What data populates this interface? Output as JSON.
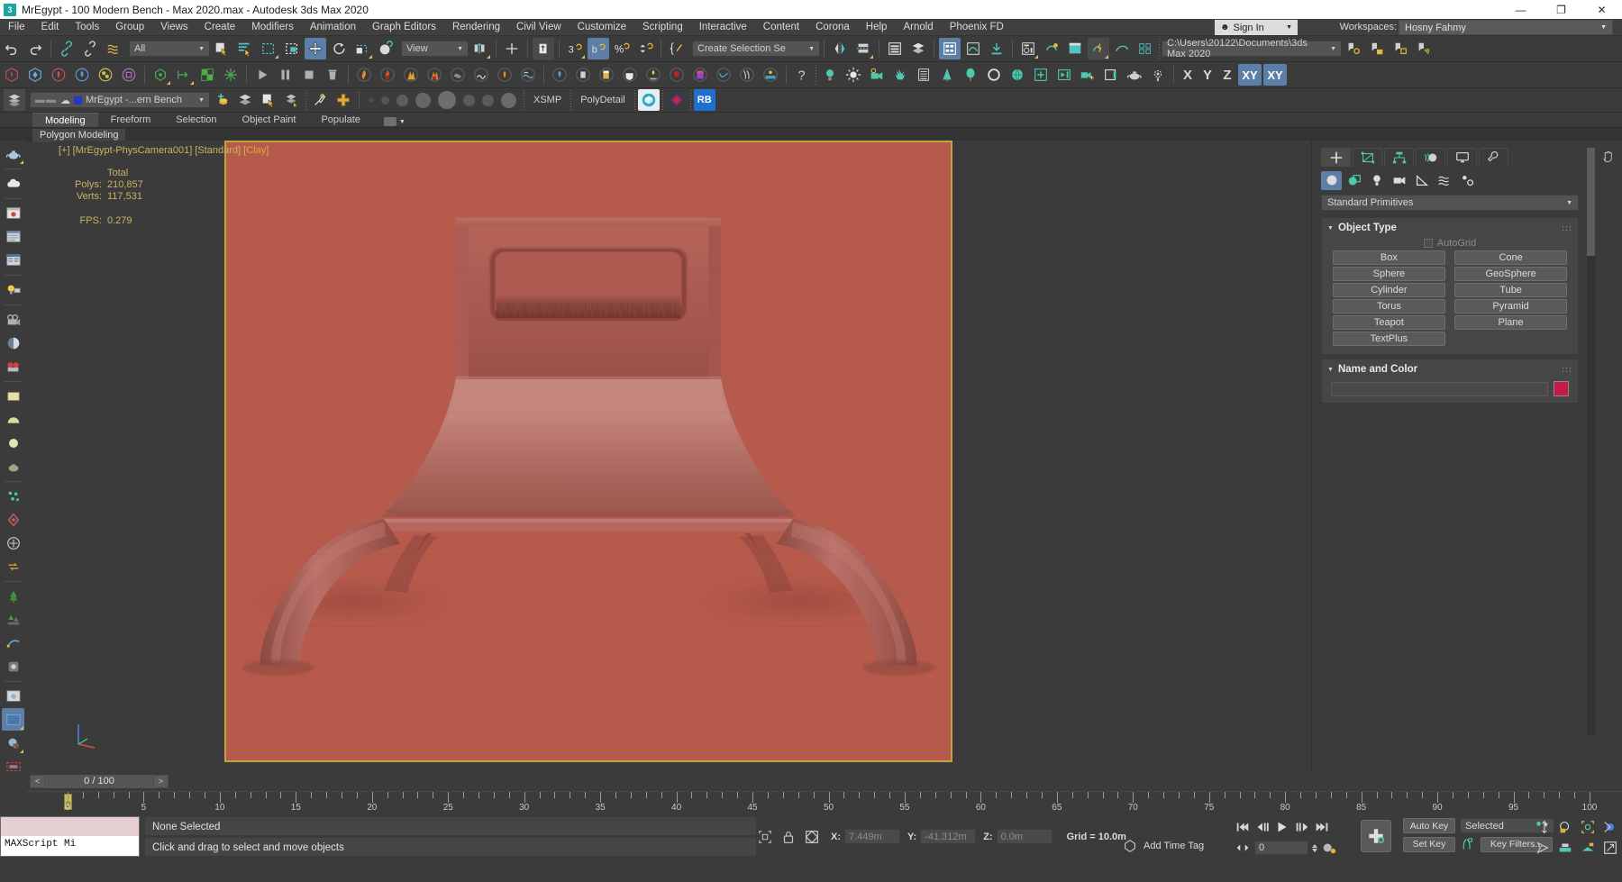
{
  "window": {
    "title": "MrEgypt - 100 Modern Bench - Max 2020.max - Autodesk 3ds Max 2020",
    "app_badge": "3",
    "minimize": "—",
    "maximize": "❐",
    "close": "✕"
  },
  "menu": {
    "items": [
      "File",
      "Edit",
      "Tools",
      "Group",
      "Views",
      "Create",
      "Modifiers",
      "Animation",
      "Graph Editors",
      "Rendering",
      "Civil View",
      "Customize",
      "Scripting",
      "Interactive",
      "Content",
      "Corona",
      "Help",
      "Arnold",
      "Phoenix FD"
    ],
    "sign_in": "Sign In",
    "workspaces_label": "Workspaces:",
    "workspace_value": "Hosny Fahmy"
  },
  "toolbar": {
    "selection_filter": "All",
    "reference_coord": "View",
    "named_selection_sets": "Create Selection Se",
    "project_folder": "C:\\Users\\20122\\Documents\\3ds Max 2020",
    "axis_x": "X",
    "axis_y": "Y",
    "axis_z": "Z",
    "axis_xy": "XY",
    "axis_xy2": "XY",
    "layer_name": "MrEgypt -...ern Bench",
    "plugin_xsmp": "XSMP",
    "plugin_polydetail": "PolyDetail",
    "plugin_rb": "RB"
  },
  "ribbon": {
    "tabs": [
      "Modeling",
      "Freeform",
      "Selection",
      "Object Paint",
      "Populate"
    ],
    "active_tab": "Modeling",
    "subtab": "Polygon Modeling"
  },
  "viewport": {
    "label_prefix": "[+]",
    "label_camera": "[MrEgypt-PhysCamera001]",
    "label_shading": "[Standard]",
    "label_style": "[",
    "label_style_name": "Clay",
    "label_style_close": "]",
    "stats_header": "Total",
    "stats_polys_label": "Polys:",
    "stats_polys_value": "210,857",
    "stats_verts_label": "Verts:",
    "stats_verts_value": "117,531",
    "stats_fps_label": "FPS:",
    "stats_fps_value": "0.279",
    "bg_color": "#b65a4b",
    "border_color": "#c2a33e"
  },
  "command_panel": {
    "category": "Standard Primitives",
    "rollout_object_type": "Object Type",
    "autogrid": "AutoGrid",
    "object_buttons": [
      "Box",
      "Cone",
      "Sphere",
      "GeoSphere",
      "Cylinder",
      "Tube",
      "Torus",
      "Pyramid",
      "Teapot",
      "Plane",
      "TextPlus"
    ],
    "rollout_name_color": "Name and Color",
    "name_value": "",
    "color_value": "#c7184c"
  },
  "timeline": {
    "prev_label": "<",
    "next_label": ">",
    "frame_display": "0 / 100",
    "ticks": [
      0,
      5,
      10,
      15,
      20,
      25,
      30,
      35,
      40,
      45,
      50,
      55,
      60,
      65,
      70,
      75,
      80,
      85,
      90,
      95,
      100
    ],
    "current_frame_marker": "0"
  },
  "status": {
    "maxscript_label": "MAXScript Mi",
    "selection": "None Selected",
    "prompt": "Click and drag to select and move objects",
    "x_label": "X:",
    "x_value": "7.449m",
    "y_label": "Y:",
    "y_value": "-41.312m",
    "z_label": "Z:",
    "z_value": "0.0m",
    "grid": "Grid = 10.0m",
    "add_time_tag": "Add Time Tag",
    "auto_key": "Auto Key",
    "set_key": "Set Key",
    "key_filters": "Key Filters...",
    "selected_filter": "Selected",
    "frame_spinner": "0"
  }
}
